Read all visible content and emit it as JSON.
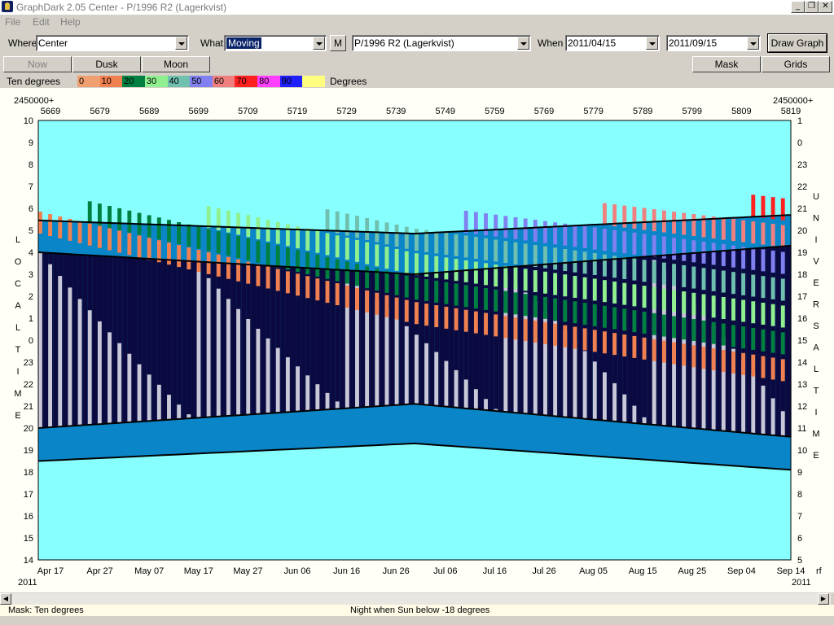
{
  "window": {
    "title": "GraphDark 2.05  Center  -  P/1996 R2 (Lagerkvist)",
    "controls": [
      "_",
      "❐",
      "✕"
    ]
  },
  "menu": [
    "File",
    "Edit",
    "Help"
  ],
  "toolbar": {
    "where_label": "Where",
    "where_value": "Center",
    "what_label": "What",
    "what_value": "Moving",
    "m_button": "M",
    "object_value": "P/1996 R2 (Lagerkvist)",
    "when_label": "When",
    "start_date": "2011/04/15",
    "end_date": "2011/09/15",
    "draw_button": "Draw Graph"
  },
  "buttons_row": {
    "now": "Now",
    "dusk": "Dusk",
    "moon": "Moon",
    "mask": "Mask",
    "grids": "Grids"
  },
  "legend": {
    "left_label": "Ten degrees",
    "right_label": "Degrees",
    "bands": [
      {
        "label": "0",
        "color": "#f0a070"
      },
      {
        "label": "10",
        "color": "#f08050"
      },
      {
        "label": "20",
        "color": "#008040"
      },
      {
        "label": "30",
        "color": "#90f090"
      },
      {
        "label": "40",
        "color": "#70c0b0"
      },
      {
        "label": "50",
        "color": "#8080f0"
      },
      {
        "label": "60",
        "color": "#f08080"
      },
      {
        "label": "70",
        "color": "#ff2020"
      },
      {
        "label": "80",
        "color": "#ff40ff"
      },
      {
        "label": "90",
        "color": "#2020ff"
      },
      {
        "label": "",
        "color": "#ffff80"
      }
    ]
  },
  "chart_data": {
    "type": "area",
    "top_axis_prefix_left": "2450000+",
    "top_axis_prefix_right": "2450000+",
    "jd_ticks": [
      "5669",
      "5679",
      "5689",
      "5699",
      "5709",
      "5719",
      "5729",
      "5739",
      "5749",
      "5759",
      "5769",
      "5779",
      "5789",
      "5799",
      "5809",
      "5819"
    ],
    "date_ticks": [
      "Apr 17",
      "Apr 27",
      "May 07",
      "May 17",
      "May 27",
      "Jun 06",
      "Jun 16",
      "Jun 26",
      "Jul 06",
      "Jul 16",
      "Jul 26",
      "Aug 05",
      "Aug 15",
      "Aug 25",
      "Sep 04",
      "Sep 14"
    ],
    "year_left": "2011",
    "year_right": "2011",
    "rf_label": "rf",
    "left_axis_title": "LOCAL TIME",
    "right_axis_title": "UNIVERSAL TIME",
    "local_ticks": [
      "10",
      "9",
      "8",
      "7",
      "6",
      "5",
      "4",
      "3",
      "2",
      "1",
      "0",
      "23",
      "22",
      "21",
      "20",
      "19",
      "18",
      "17",
      "16",
      "15",
      "14"
    ],
    "ut_ticks": [
      "1",
      "0",
      "23",
      "22",
      "21",
      "20",
      "19",
      "18",
      "17",
      "16",
      "15",
      "14",
      "13",
      "12",
      "11",
      "10",
      "9",
      "8",
      "7",
      "6",
      "5"
    ],
    "sky_color": "#88ffff",
    "twilight_color": "#0a86c8",
    "night_color": "#0a0a40",
    "moon_color": "#c8c8d8",
    "dawn_local_start": 4.0,
    "dawn_local_mid": 3.0,
    "dawn_local_end": 4.3,
    "dusk_local_start": 20.0,
    "dusk_local_mid": 21.1,
    "dusk_local_end": 19.6,
    "sunrise_local_start": 5.45,
    "sunrise_local_mid": 4.85,
    "sunrise_local_end": 5.7,
    "sunset_local_start": 18.5,
    "sunset_local_mid": 19.3,
    "sunset_local_end": 18.1,
    "rows": 21
  },
  "status": {
    "mask": "Mask:  Ten degrees",
    "night": "Night when Sun below -18 degrees"
  }
}
